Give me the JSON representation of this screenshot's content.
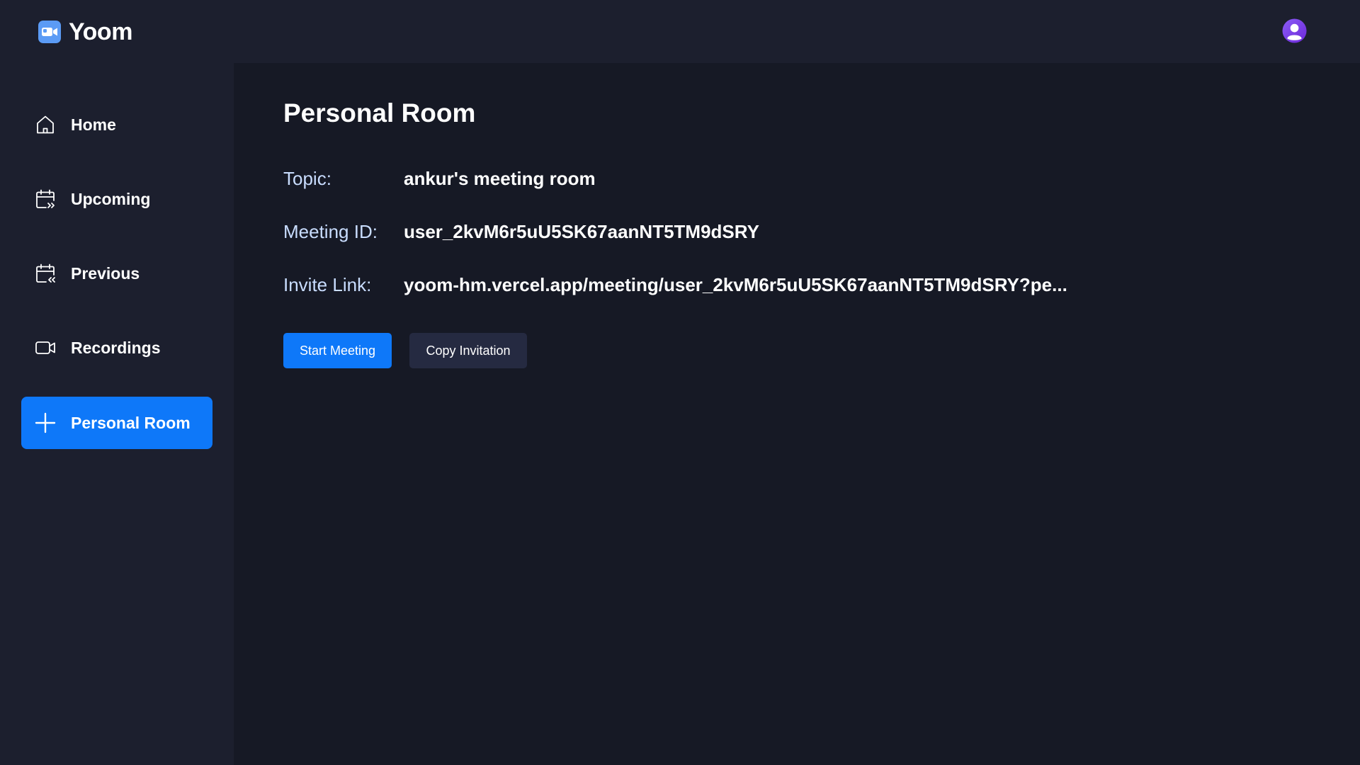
{
  "app": {
    "name": "Yoom",
    "logo_icon": "video-camera-icon",
    "accent_color": "#0E78F9"
  },
  "header": {
    "avatar_icon": "user-avatar-icon"
  },
  "sidebar": {
    "items": [
      {
        "label": "Home",
        "icon": "home-icon",
        "active": false
      },
      {
        "label": "Upcoming",
        "icon": "calendar-upcoming-icon",
        "active": false
      },
      {
        "label": "Previous",
        "icon": "calendar-previous-icon",
        "active": false
      },
      {
        "label": "Recordings",
        "icon": "video-recording-icon",
        "active": false
      },
      {
        "label": "Personal Room",
        "icon": "plus-icon",
        "active": true
      }
    ]
  },
  "main": {
    "title": "Personal Room",
    "details": [
      {
        "label": "Topic:",
        "value": "ankur's meeting room"
      },
      {
        "label": "Meeting ID:",
        "value": "user_2kvM6r5uU5SK67aanNT5TM9dSRY"
      },
      {
        "label": "Invite Link:",
        "value": "yoom-hm.vercel.app/meeting/user_2kvM6r5uU5SK67aanNT5TM9dSRY?pe..."
      }
    ],
    "start_button": "Start Meeting",
    "copy_button": "Copy Invitation"
  }
}
